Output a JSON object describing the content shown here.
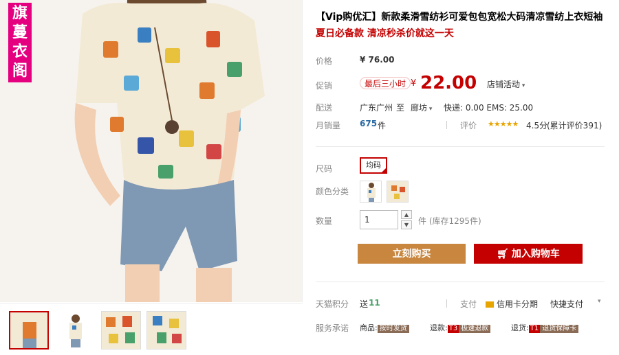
{
  "gallery": {
    "shop_tag": "旗蔓衣阁",
    "thumbnail_count": 4
  },
  "product": {
    "title": "【Vip购优汇】新款柔滑雪纺衫可爱包包宽松大码清凉雪纺上衣短袖",
    "subtitle": "夏日必备款 清凉秒杀价就这一天"
  },
  "price": {
    "label": "价格",
    "original": "¥ 76.00"
  },
  "promo": {
    "label": "促销",
    "badge": "最后三小时",
    "yen": "¥",
    "price": "22.00",
    "shop_activity": "店铺活动"
  },
  "shipping": {
    "label": "配送",
    "from": "广东广州",
    "to_word": "至",
    "to": "廊坊",
    "fees": "快递: 0.00  EMS: 25.00"
  },
  "sales": {
    "label": "月销量",
    "count": "675",
    "unit": "件",
    "rating_label": "评价",
    "stars": "★★★★★",
    "score": "4.5分",
    "reviews": "(累计评价391)"
  },
  "options": {
    "size_label": "尺码",
    "size_value": "均码",
    "color_label": "颜色分类",
    "qty_label": "数量",
    "qty_value": "1",
    "stock": "件 (库存1295件)"
  },
  "actions": {
    "buy": "立刻购买",
    "cart": "加入购物车"
  },
  "points": {
    "label": "天猫积分",
    "send": "送",
    "value": "11",
    "pay_label": "支付",
    "credit": "信用卡分期",
    "quick": "快捷支付"
  },
  "service": {
    "label": "服务承诺",
    "goods": "商品:",
    "goods_tag": "按时发货",
    "refund": "退款:",
    "refund_code": "T3",
    "refund_tag": "极速退款",
    "return": "退货:",
    "return_code": "T1",
    "return_tag": "退货保障卡"
  },
  "colors": {
    "accent": "#c40000",
    "buy_button": "#c8863f",
    "shop_tag": "#e4007f"
  }
}
